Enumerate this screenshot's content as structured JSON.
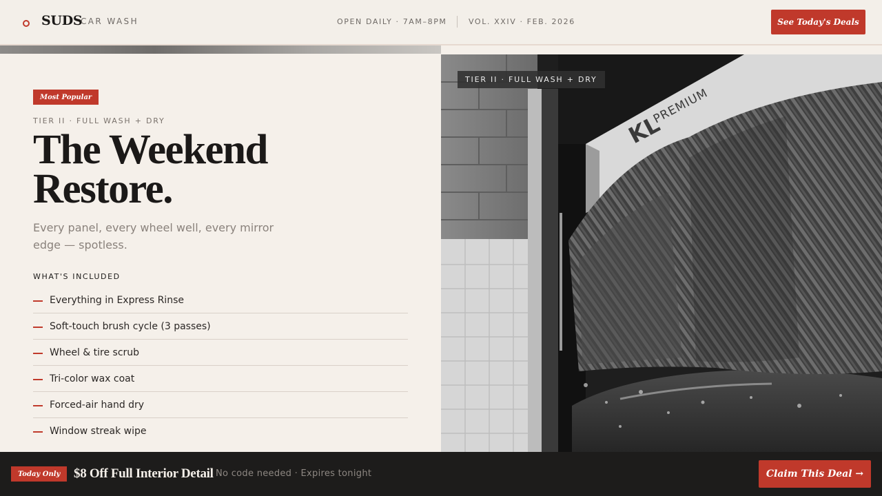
{
  "header": {
    "brand": "SUDS",
    "brand_sub": "CAR WASH",
    "hours": "OPEN DAILY · 7AM–8PM",
    "volume": "VOL. XXIV · FEB. 2026",
    "deals_button": "See Today's Deals"
  },
  "hero": {
    "badge": "Most Popular",
    "tier": "TIER II · FULL WASH + DRY",
    "title_line1": "The Weekend",
    "title_line2": "Restore.",
    "subtitle": "Every panel, every wheel well, every mirror edge — spotless.",
    "included_heading": "WHAT'S INCLUDED",
    "features": [
      "Everything in Express Rinse",
      "Soft-touch brush cycle (3 passes)",
      "Wheel & tire scrub",
      "Tri-color wax coat",
      "Forced-air hand dry",
      "Window streak wipe"
    ]
  },
  "photo": {
    "tag": "TIER II · FULL WASH + DRY",
    "machine_brand": "KL",
    "machine_model": "PREMIUM"
  },
  "deal_bar": {
    "badge": "Today Only",
    "title": "$8 Off Full Interior Detail",
    "note": "No code needed · Expires tonight",
    "button": "Claim This Deal →"
  },
  "colors": {
    "accent": "#c0392b",
    "background": "#f5f0ea",
    "dark": "#1d1c1b"
  }
}
